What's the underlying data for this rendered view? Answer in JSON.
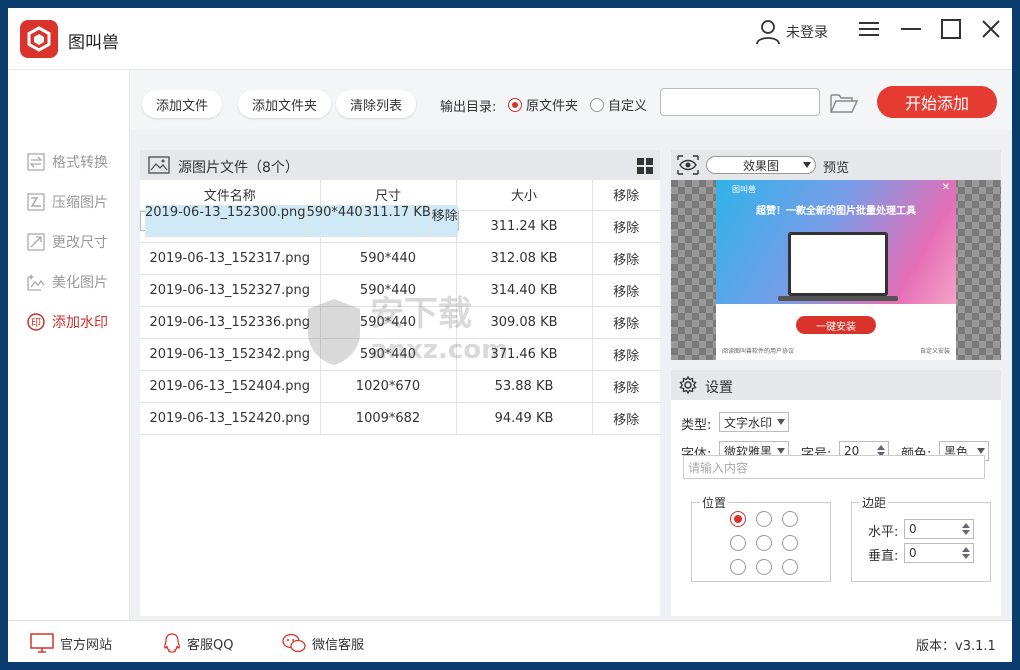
{
  "app": {
    "title": "图叫兽",
    "login": "未登录"
  },
  "sidebar": {
    "items": [
      {
        "label": "格式转换",
        "icon": "format-convert-icon"
      },
      {
        "label": "压缩图片",
        "icon": "compress-icon"
      },
      {
        "label": "更改尺寸",
        "icon": "resize-icon"
      },
      {
        "label": "美化图片",
        "icon": "beautify-icon"
      },
      {
        "label": "添加水印",
        "icon": "watermark-icon"
      }
    ],
    "active_index": 4
  },
  "toolbar": {
    "add_file": "添加文件",
    "add_folder": "添加文件夹",
    "clear_list": "清除列表",
    "output_label": "输出目录:",
    "opt_original": "原文件夹",
    "opt_custom": "自定义",
    "path_value": "",
    "start": "开始添加"
  },
  "files": {
    "title": "源图片文件（8个）",
    "columns": [
      "文件名称",
      "尺寸",
      "大小",
      "移除"
    ],
    "rows": [
      [
        "2019-06-13_152300.png",
        "590*440",
        "311.17 KB",
        "移除"
      ],
      [
        "2019-06-13_152307.png",
        "590*440",
        "311.24 KB",
        "移除"
      ],
      [
        "2019-06-13_152317.png",
        "590*440",
        "312.08 KB",
        "移除"
      ],
      [
        "2019-06-13_152327.png",
        "590*440",
        "314.40 KB",
        "移除"
      ],
      [
        "2019-06-13_152336.png",
        "590*440",
        "309.08 KB",
        "移除"
      ],
      [
        "2019-06-13_152342.png",
        "590*440",
        "371.46 KB",
        "移除"
      ],
      [
        "2019-06-13_152404.png",
        "1020*670",
        "53.88 KB",
        "移除"
      ],
      [
        "2019-06-13_152420.png",
        "1009*682",
        "94.49 KB",
        "移除"
      ]
    ]
  },
  "preview": {
    "mode": "效果图",
    "label": "预览",
    "ad_brand": "图叫兽",
    "ad_title": "超赞！一款全新的图片批量处理工具",
    "ad_button": "一键安装",
    "ad_agree": "阅读图叫兽软件的用户协议",
    "ad_custom": "自定义安装"
  },
  "settings": {
    "title": "设置",
    "type_label": "类型:",
    "type_value": "文字水印",
    "font_label": "字体:",
    "font_value": "微软雅黑",
    "size_label": "字号:",
    "size_value": "20",
    "color_label": "颜色:",
    "color_value": "黑色",
    "content_placeholder": "请输入内容",
    "position_label": "位置",
    "margin_label": "边距",
    "h_label": "水平:",
    "h_value": "0",
    "v_label": "垂直:",
    "v_value": "0"
  },
  "footer": {
    "site": "官方网站",
    "qq": "客服QQ",
    "wechat": "微信客服",
    "version": "版本：v3.1.1"
  },
  "watermark": {
    "text": "安下载",
    "sub": "anxz.com"
  },
  "colors": {
    "accent": "#d9332b",
    "selected_row": "#cfe9f7"
  }
}
